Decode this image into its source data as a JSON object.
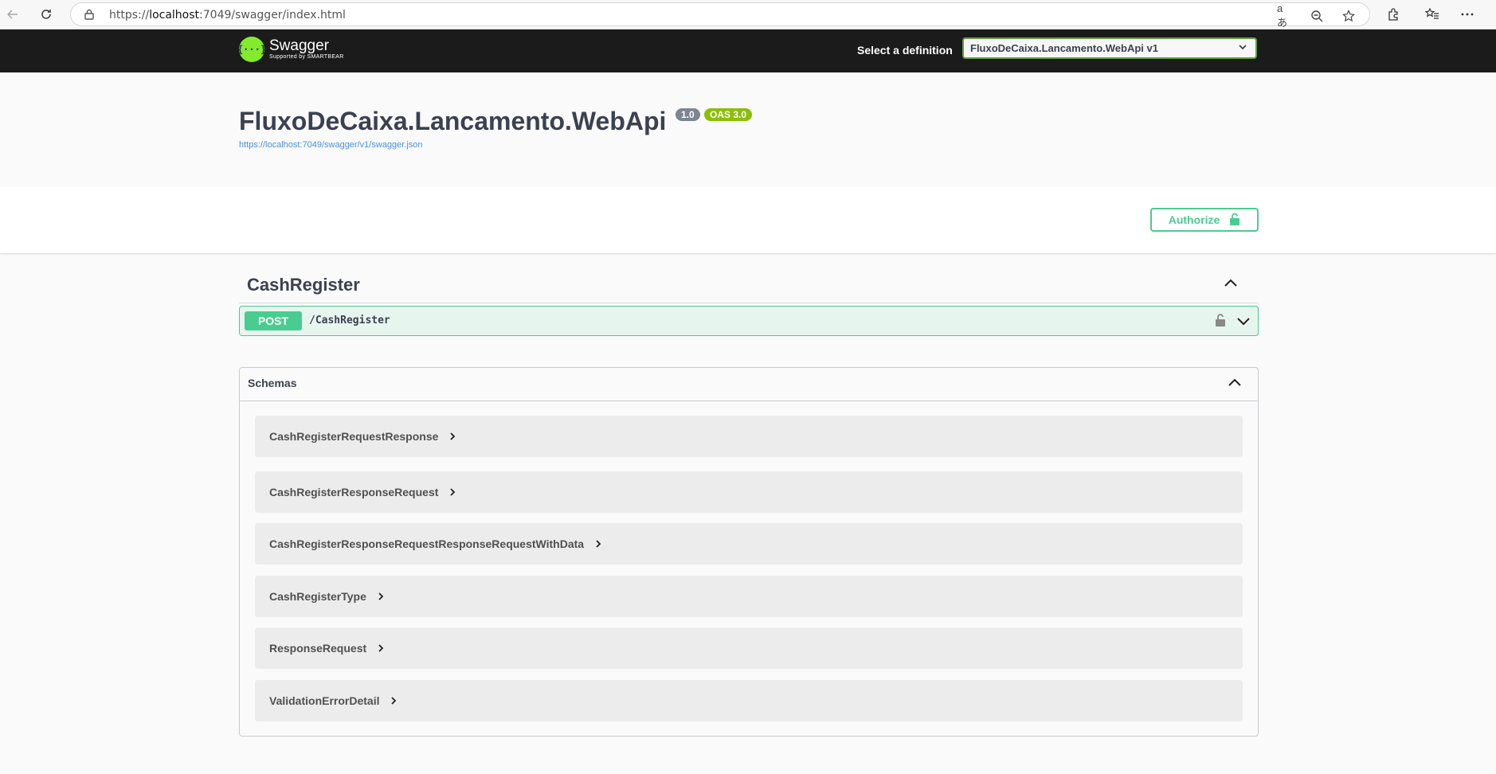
{
  "browser": {
    "url_prefix": "https://",
    "url_host": "localhost",
    "url_rest": ":7049/swagger/index.html",
    "read_aloud_label": "aあ"
  },
  "topbar": {
    "logo_text": "Swagger",
    "logo_subtext": "Supported by SMARTBEAR",
    "logo_glyph": "{···}",
    "definition_label": "Select a definition",
    "definition_value": "FluxoDeCaixa.Lancamento.WebApi v1"
  },
  "info": {
    "title": "FluxoDeCaixa.Lancamento.WebApi",
    "version": "1.0",
    "oas": "OAS 3.0",
    "spec_link": "https://localhost:7049/swagger/v1/swagger.json"
  },
  "auth": {
    "button_label": "Authorize"
  },
  "tag": {
    "name": "CashRegister",
    "operation": {
      "method": "POST",
      "path": "/CashRegister"
    }
  },
  "schemas": {
    "title": "Schemas",
    "models": [
      "CashRegisterRequestResponse",
      "CashRegisterResponseRequest",
      "CashRegisterResponseRequestResponseRequestWithData",
      "CashRegisterType",
      "ResponseRequest",
      "ValidationErrorDetail"
    ]
  },
  "colors": {
    "topbar": "#1b1b1b",
    "swagger_green": "#85ea2d",
    "post_green": "#49cc90",
    "link_blue": "#4990e2",
    "version_badge": "#7d8492",
    "oas_badge": "#89bf04"
  }
}
